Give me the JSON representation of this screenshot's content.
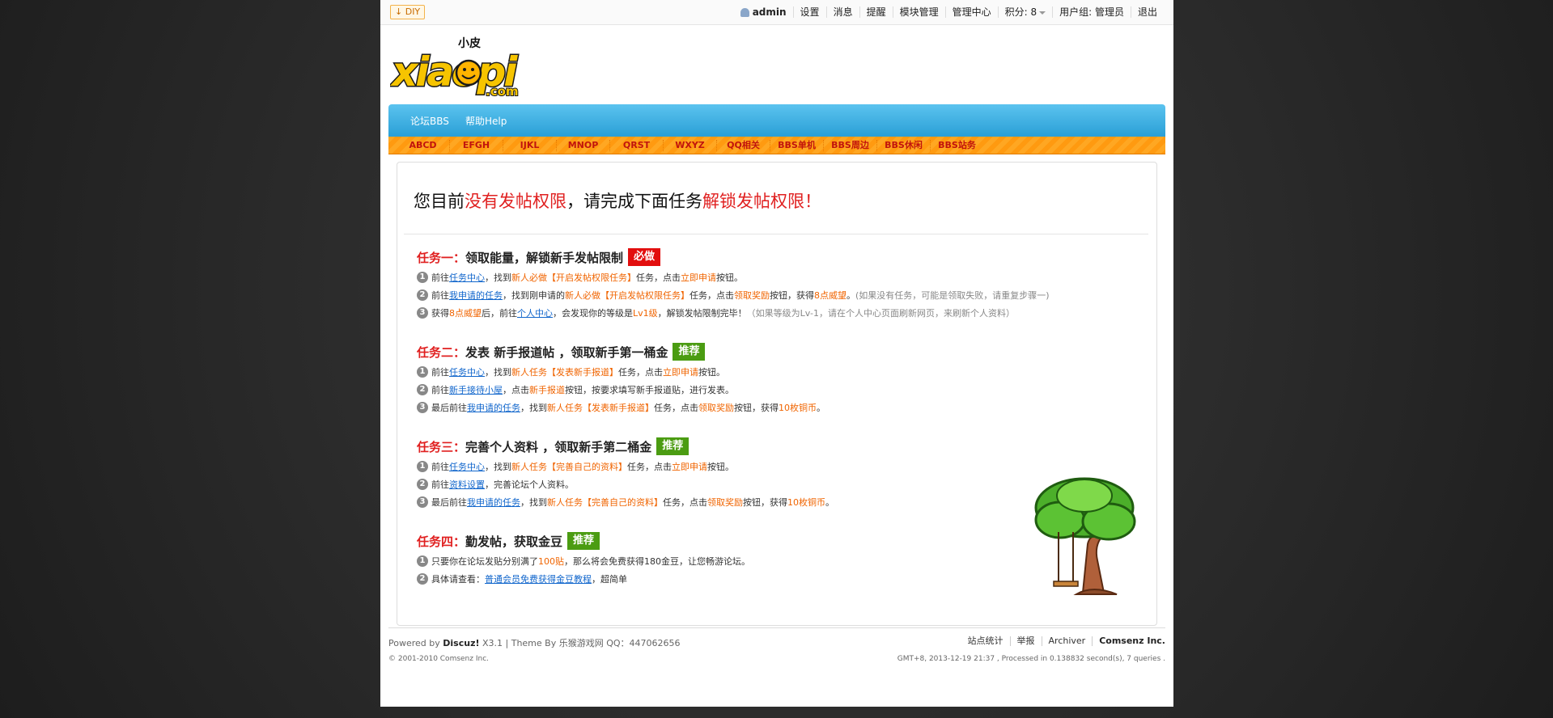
{
  "topbar": {
    "diy": "DIY",
    "username": "admin",
    "links": [
      "设置",
      "消息",
      "提醒",
      "模块管理",
      "管理中心"
    ],
    "points": "积分: 8",
    "usergroup": "用户组: 管理员",
    "logout": "退出"
  },
  "logo": {
    "top": "小皮",
    "main": "xiaopi",
    "sub": ".com"
  },
  "nav": {
    "items": [
      "论坛BBS",
      "帮助Help"
    ]
  },
  "subnav": [
    "ABCD",
    "EFGH",
    "IJKL",
    "MNOP",
    "QRST",
    "WXYZ",
    "QQ相关",
    "BBS单机",
    "BBS周边",
    "BBS休闲",
    "BBS站务"
  ],
  "headline": {
    "p1": "您目前",
    "p2": "没有发帖权限",
    "p3": "，请完成下面任务",
    "p4": "解锁发帖权限！"
  },
  "tasks": [
    {
      "num": "任务一：",
      "title": "领取能量，解锁新手发帖限制",
      "badge": "必做",
      "steps": [
        [
          "前往 ",
          "任务中心",
          "，找到 ",
          "新人必做【开启发帖权限任务】",
          " 任务，点击",
          "立即申请",
          "按钮。"
        ],
        [
          "前往 ",
          "我申请的任务",
          "，找到刚申请的 ",
          "新人必做【开启发帖权限任务】",
          " 任务，点击",
          "领取奖励",
          "按钮，获得",
          "8点威望",
          "。",
          "(如果没有任务，可能是领取失败，请重复步骤一)"
        ],
        [
          "获得",
          "8点威望",
          "后，前往 ",
          "个人中心",
          "，会发现你的等级是",
          "Lv1级",
          "，解锁发帖限制完毕！",
          "（如果等级为Lv-1，请在个人中心页面刷新网页，来刷新个人资料）"
        ]
      ]
    },
    {
      "num": "任务二：",
      "title": "发表 新手报道帖 ，领取新手第一桶金",
      "badge": "推荐",
      "steps": [
        [
          "前往 ",
          "任务中心",
          "，找到 ",
          "新人任务【发表新手报道】",
          " 任务，点击",
          "立即申请",
          "按钮。"
        ],
        [
          "前往 ",
          "新手接待小屋",
          "，点击",
          "新手报道",
          "按钮，按要求填写新手报道贴，进行发表。"
        ],
        [
          "最后前往 ",
          "我申请的任务",
          "，找到 ",
          "新人任务【发表新手报道】",
          " 任务，点击",
          "领取奖励",
          "按钮，获得",
          "10枚铜币",
          "。"
        ]
      ]
    },
    {
      "num": "任务三：",
      "title": "完善个人资料 ，领取新手第二桶金",
      "badge": "推荐",
      "steps": [
        [
          "前往 ",
          "任务中心",
          "，找到 ",
          "新人任务【完善自己的资料】",
          " 任务，点击",
          "立即申请",
          "按钮。"
        ],
        [
          "前往 ",
          "资料设置",
          "，完善论坛个人资料。"
        ],
        [
          "最后前往 ",
          "我申请的任务",
          "，找到 ",
          "新人任务【完善自己的资料】",
          " 任务，点击",
          "领取奖励",
          "按钮，获得",
          "10枚铜币",
          "。"
        ]
      ]
    },
    {
      "num": "任务四：",
      "title": "勤发帖，获取金豆",
      "badge": "推荐",
      "steps": [
        [
          "只要你在论坛发贴分别满了",
          "100贴",
          "，那么将会免费获得180金豆，让您畅游论坛。"
        ],
        [
          "具体请查看：",
          "普通会员免费获得金豆教程",
          "，超简单"
        ]
      ]
    }
  ],
  "footer": {
    "powered": "Powered by",
    "discuz": "Discuz!",
    "theme": "X3.1 | Theme By 乐猴游戏网 QQ：447062656",
    "copyright": "© 2001-2010 Comsenz Inc.",
    "links": [
      "站点统计",
      "举报",
      "Archiver",
      "Comsenz Inc."
    ],
    "stats": "GMT+8, 2013-12-19 21:37 , Processed in 0.138832 second(s), 7 queries ."
  }
}
